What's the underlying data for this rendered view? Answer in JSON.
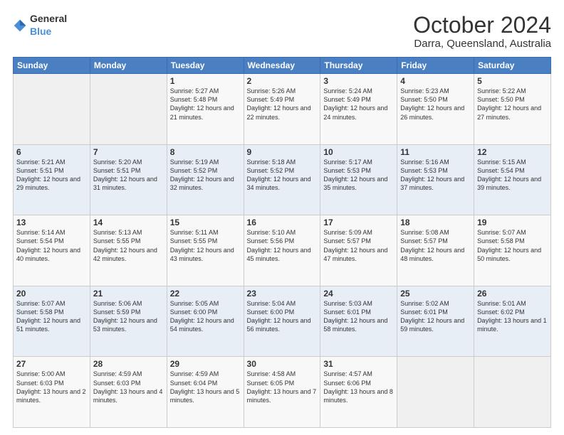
{
  "header": {
    "logo_general": "General",
    "logo_blue": "Blue",
    "month": "October 2024",
    "location": "Darra, Queensland, Australia"
  },
  "weekdays": [
    "Sunday",
    "Monday",
    "Tuesday",
    "Wednesday",
    "Thursday",
    "Friday",
    "Saturday"
  ],
  "weeks": [
    [
      {
        "day": "",
        "info": ""
      },
      {
        "day": "",
        "info": ""
      },
      {
        "day": "1",
        "info": "Sunrise: 5:27 AM\nSunset: 5:48 PM\nDaylight: 12 hours\nand 21 minutes."
      },
      {
        "day": "2",
        "info": "Sunrise: 5:26 AM\nSunset: 5:49 PM\nDaylight: 12 hours\nand 22 minutes."
      },
      {
        "day": "3",
        "info": "Sunrise: 5:24 AM\nSunset: 5:49 PM\nDaylight: 12 hours\nand 24 minutes."
      },
      {
        "day": "4",
        "info": "Sunrise: 5:23 AM\nSunset: 5:50 PM\nDaylight: 12 hours\nand 26 minutes."
      },
      {
        "day": "5",
        "info": "Sunrise: 5:22 AM\nSunset: 5:50 PM\nDaylight: 12 hours\nand 27 minutes."
      }
    ],
    [
      {
        "day": "6",
        "info": "Sunrise: 5:21 AM\nSunset: 5:51 PM\nDaylight: 12 hours\nand 29 minutes."
      },
      {
        "day": "7",
        "info": "Sunrise: 5:20 AM\nSunset: 5:51 PM\nDaylight: 12 hours\nand 31 minutes."
      },
      {
        "day": "8",
        "info": "Sunrise: 5:19 AM\nSunset: 5:52 PM\nDaylight: 12 hours\nand 32 minutes."
      },
      {
        "day": "9",
        "info": "Sunrise: 5:18 AM\nSunset: 5:52 PM\nDaylight: 12 hours\nand 34 minutes."
      },
      {
        "day": "10",
        "info": "Sunrise: 5:17 AM\nSunset: 5:53 PM\nDaylight: 12 hours\nand 35 minutes."
      },
      {
        "day": "11",
        "info": "Sunrise: 5:16 AM\nSunset: 5:53 PM\nDaylight: 12 hours\nand 37 minutes."
      },
      {
        "day": "12",
        "info": "Sunrise: 5:15 AM\nSunset: 5:54 PM\nDaylight: 12 hours\nand 39 minutes."
      }
    ],
    [
      {
        "day": "13",
        "info": "Sunrise: 5:14 AM\nSunset: 5:54 PM\nDaylight: 12 hours\nand 40 minutes."
      },
      {
        "day": "14",
        "info": "Sunrise: 5:13 AM\nSunset: 5:55 PM\nDaylight: 12 hours\nand 42 minutes."
      },
      {
        "day": "15",
        "info": "Sunrise: 5:11 AM\nSunset: 5:55 PM\nDaylight: 12 hours\nand 43 minutes."
      },
      {
        "day": "16",
        "info": "Sunrise: 5:10 AM\nSunset: 5:56 PM\nDaylight: 12 hours\nand 45 minutes."
      },
      {
        "day": "17",
        "info": "Sunrise: 5:09 AM\nSunset: 5:57 PM\nDaylight: 12 hours\nand 47 minutes."
      },
      {
        "day": "18",
        "info": "Sunrise: 5:08 AM\nSunset: 5:57 PM\nDaylight: 12 hours\nand 48 minutes."
      },
      {
        "day": "19",
        "info": "Sunrise: 5:07 AM\nSunset: 5:58 PM\nDaylight: 12 hours\nand 50 minutes."
      }
    ],
    [
      {
        "day": "20",
        "info": "Sunrise: 5:07 AM\nSunset: 5:58 PM\nDaylight: 12 hours\nand 51 minutes."
      },
      {
        "day": "21",
        "info": "Sunrise: 5:06 AM\nSunset: 5:59 PM\nDaylight: 12 hours\nand 53 minutes."
      },
      {
        "day": "22",
        "info": "Sunrise: 5:05 AM\nSunset: 6:00 PM\nDaylight: 12 hours\nand 54 minutes."
      },
      {
        "day": "23",
        "info": "Sunrise: 5:04 AM\nSunset: 6:00 PM\nDaylight: 12 hours\nand 56 minutes."
      },
      {
        "day": "24",
        "info": "Sunrise: 5:03 AM\nSunset: 6:01 PM\nDaylight: 12 hours\nand 58 minutes."
      },
      {
        "day": "25",
        "info": "Sunrise: 5:02 AM\nSunset: 6:01 PM\nDaylight: 12 hours\nand 59 minutes."
      },
      {
        "day": "26",
        "info": "Sunrise: 5:01 AM\nSunset: 6:02 PM\nDaylight: 13 hours\nand 1 minute."
      }
    ],
    [
      {
        "day": "27",
        "info": "Sunrise: 5:00 AM\nSunset: 6:03 PM\nDaylight: 13 hours\nand 2 minutes."
      },
      {
        "day": "28",
        "info": "Sunrise: 4:59 AM\nSunset: 6:03 PM\nDaylight: 13 hours\nand 4 minutes."
      },
      {
        "day": "29",
        "info": "Sunrise: 4:59 AM\nSunset: 6:04 PM\nDaylight: 13 hours\nand 5 minutes."
      },
      {
        "day": "30",
        "info": "Sunrise: 4:58 AM\nSunset: 6:05 PM\nDaylight: 13 hours\nand 7 minutes."
      },
      {
        "day": "31",
        "info": "Sunrise: 4:57 AM\nSunset: 6:06 PM\nDaylight: 13 hours\nand 8 minutes."
      },
      {
        "day": "",
        "info": ""
      },
      {
        "day": "",
        "info": ""
      }
    ]
  ]
}
